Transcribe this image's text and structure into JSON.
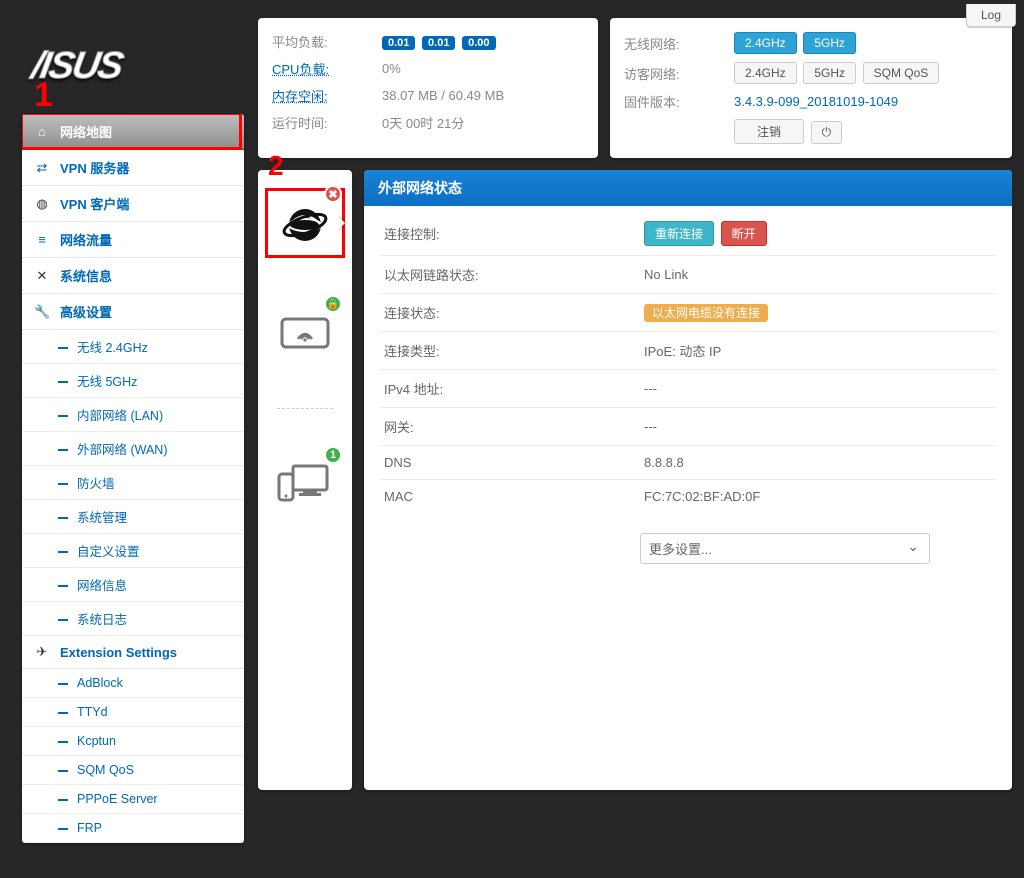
{
  "log_label": "Log",
  "annotations": {
    "one": "1",
    "two": "2"
  },
  "logo": "/ISUS",
  "nav": {
    "items": [
      {
        "label": "网络地图",
        "icon": "home-icon",
        "active": true
      },
      {
        "label": "VPN 服务器",
        "icon": "shuffle-icon"
      },
      {
        "label": "VPN 客户端",
        "icon": "globe-icon"
      },
      {
        "label": "网络流量",
        "icon": "bars-icon"
      },
      {
        "label": "系统信息",
        "icon": "cross-icon"
      },
      {
        "label": "高级设置",
        "icon": "wrench-icon",
        "header": true,
        "sub": [
          "无线 2.4GHz",
          "无线 5GHz",
          "内部网络 (LAN)",
          "外部网络 (WAN)",
          "防火墙",
          "系统管理",
          "自定义设置",
          "网络信息",
          "系统日志"
        ]
      },
      {
        "label": "Extension Settings",
        "icon": "plane-icon",
        "header": true,
        "sub": [
          "AdBlock",
          "TTYd",
          "Kcptun",
          "SQM QoS",
          "PPPoE Server",
          "FRP"
        ]
      }
    ]
  },
  "stats_left": {
    "avg_load_label": "平均负载:",
    "avg_load": [
      "0.01",
      "0.01",
      "0.00"
    ],
    "cpu_label": "CPU负载:",
    "cpu_val": "0%",
    "mem_label": "内存空闲:",
    "mem_val": "38.07 MB / 60.49 MB",
    "uptime_label": "运行时间:",
    "uptime_val": "0天 00时 21分"
  },
  "stats_right": {
    "wifi_label": "无线网络:",
    "wifi_btns": [
      "2.4GHz",
      "5GHz"
    ],
    "guest_label": "访客网络:",
    "guest_btns": [
      "2.4GHz",
      "5GHz",
      "SQM QoS"
    ],
    "fw_label": "固件版本:",
    "fw_val": "3.4.3.9-099_20181019-1049",
    "logout": "注销"
  },
  "icon_col": {
    "globe_badge": "✖",
    "wifi_badge": "🔒",
    "clients_badge": "1"
  },
  "detail": {
    "title": "外部网络状态",
    "rows": [
      {
        "label": "连接控制:",
        "type": "buttons",
        "btns": [
          {
            "t": "重新连接",
            "c": "teal"
          },
          {
            "t": "断开",
            "c": "red"
          }
        ]
      },
      {
        "label": "以太网链路状态:",
        "val": "No Link"
      },
      {
        "label": "连接状态:",
        "type": "badge",
        "val": "以太网电缆没有连接"
      },
      {
        "label": "连接类型:",
        "val": "IPoE: 动态 IP"
      },
      {
        "label": "IPv4 地址:",
        "val": "---"
      },
      {
        "label": "网关:",
        "val": "---"
      },
      {
        "label": "DNS",
        "val": "8.8.8.8"
      },
      {
        "label": "MAC",
        "val": "FC:7C:02:BF:AD:0F"
      }
    ],
    "more": "更多设置..."
  }
}
